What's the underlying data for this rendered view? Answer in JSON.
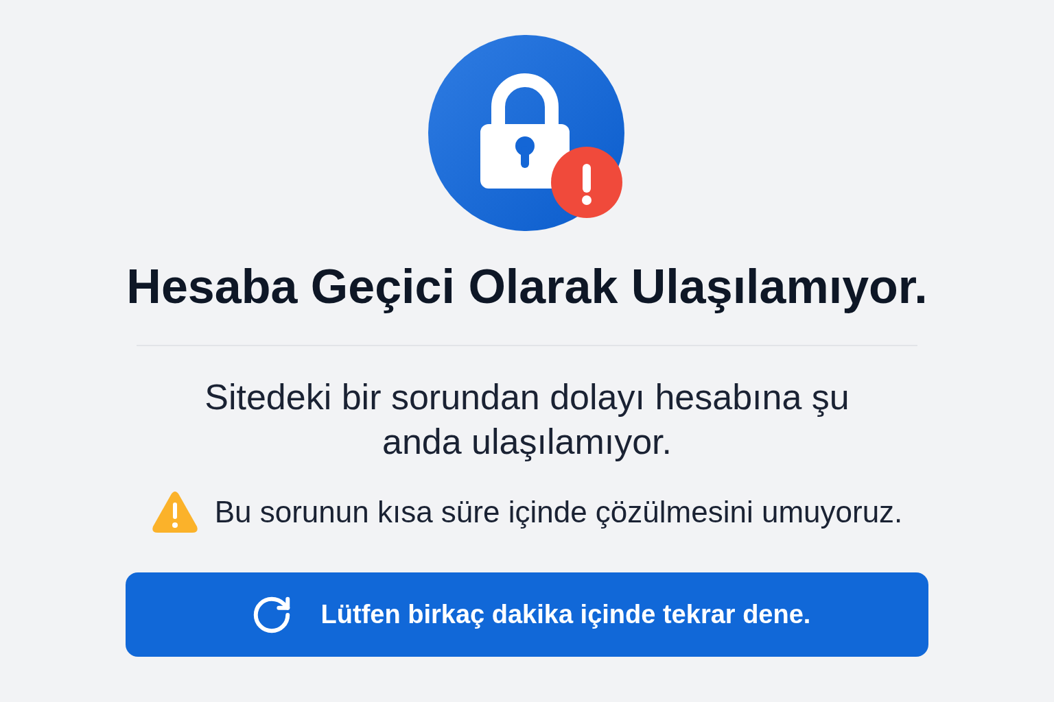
{
  "title": "Hesaba Geçici Olarak Ulaşılamıyor.",
  "message": "Sitedeki bir sorundan dolayı hesabına şu anda ulaşılamıyor.",
  "notice": {
    "text": "Bu sorunun kısa süre içinde çözülmesini umuyoruz."
  },
  "retry_button": {
    "label": "Lütfen birkaç dakika içinde tekrar dene."
  }
}
